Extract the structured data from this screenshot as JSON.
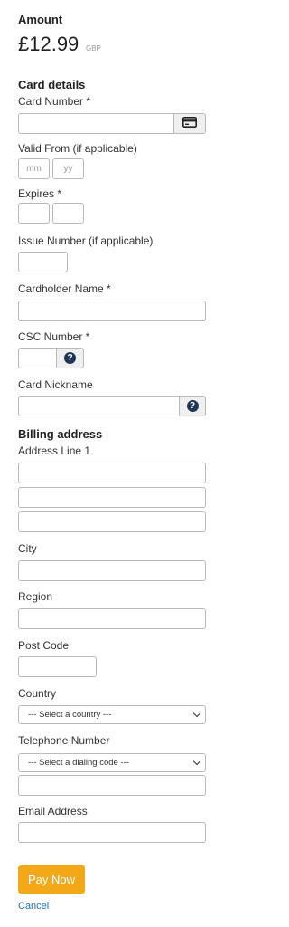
{
  "amount": {
    "heading": "Amount",
    "value": "£12.99",
    "currency": "GBP"
  },
  "card": {
    "heading": "Card details",
    "number_label": "Card Number *",
    "valid_from_label": "Valid From (if applicable)",
    "month_placeholder": "mm",
    "year_placeholder": "yy",
    "expires_label": "Expires *",
    "issue_label": "Issue Number (if applicable)",
    "holder_label": "Cardholder Name *",
    "csc_label": "CSC Number *",
    "nickname_label": "Card Nickname",
    "help_glyph": "?"
  },
  "billing": {
    "heading": "Billing address",
    "address_label": "Address Line 1",
    "city_label": "City",
    "region_label": "Region",
    "postcode_label": "Post Code",
    "country_label": "Country",
    "country_select": "--- Select a country ---",
    "telephone_label": "Telephone Number",
    "dialing_select": "--- Select a dialing code ---",
    "email_label": "Email Address"
  },
  "actions": {
    "pay_label": "Pay Now",
    "cancel_label": "Cancel"
  },
  "colors": {
    "pay_button": "#f3a817",
    "help_icon": "#1e3556",
    "cancel_link": "#1f6fb2"
  },
  "icons": {
    "card": "credit-card-icon",
    "help": "question-circle-icon",
    "dropdown": "chevron-down-icon"
  }
}
